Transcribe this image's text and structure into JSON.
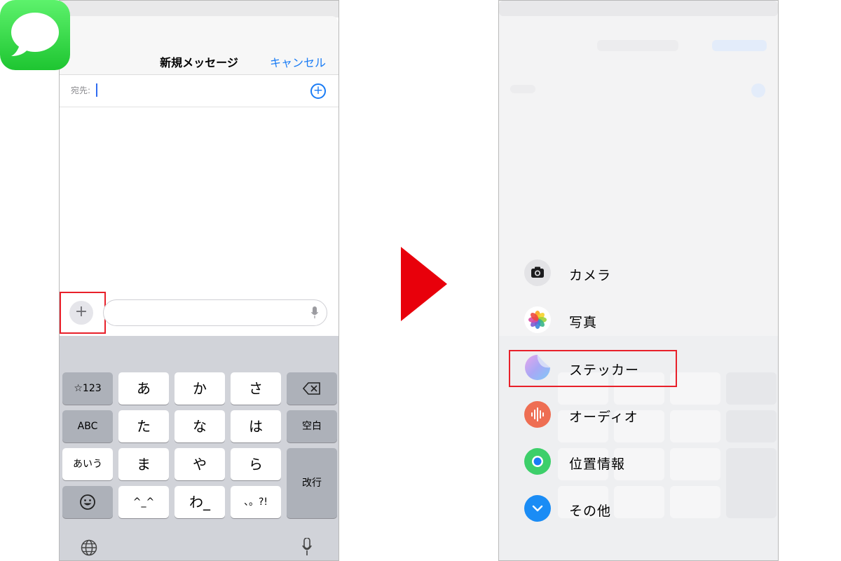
{
  "left_screen": {
    "nav": {
      "title": "新規メッセージ",
      "cancel_label": "キャンセル"
    },
    "recipient": {
      "label": "宛先:",
      "add_icon": "plus-circle-icon"
    },
    "compose": {
      "plus_icon": "plus-icon",
      "mic_icon": "microphone-icon"
    },
    "keyboard": {
      "keys": {
        "symbols": "☆123",
        "a": "あ",
        "ka": "か",
        "sa": "さ",
        "abc": "ABC",
        "ta": "た",
        "na": "な",
        "ha": "は",
        "space": "空白",
        "kana": "あいう",
        "ma": "ま",
        "ya": "や",
        "ra": "ら",
        "return": "改行",
        "kaomoji": "^_^",
        "wa": "わ_",
        "punct": "、。?!"
      },
      "icons": [
        "delete-icon",
        "emoji-icon",
        "globe-icon",
        "microphone-icon"
      ]
    }
  },
  "right_screen": {
    "menu": [
      {
        "label": "カメラ",
        "icon": "camera-icon"
      },
      {
        "label": "写真",
        "icon": "photos-icon"
      },
      {
        "label": "ステッカー",
        "icon": "sticker-icon"
      },
      {
        "label": "オーディオ",
        "icon": "audio-icon"
      },
      {
        "label": "位置情報",
        "icon": "location-icon"
      },
      {
        "label": "その他",
        "icon": "chevron-down-icon"
      }
    ]
  },
  "colors": {
    "accent_blue": "#1a7cf5",
    "highlight_red": "#e8202a",
    "arrow_red": "#e8000b",
    "messages_green": "#28c83b"
  }
}
